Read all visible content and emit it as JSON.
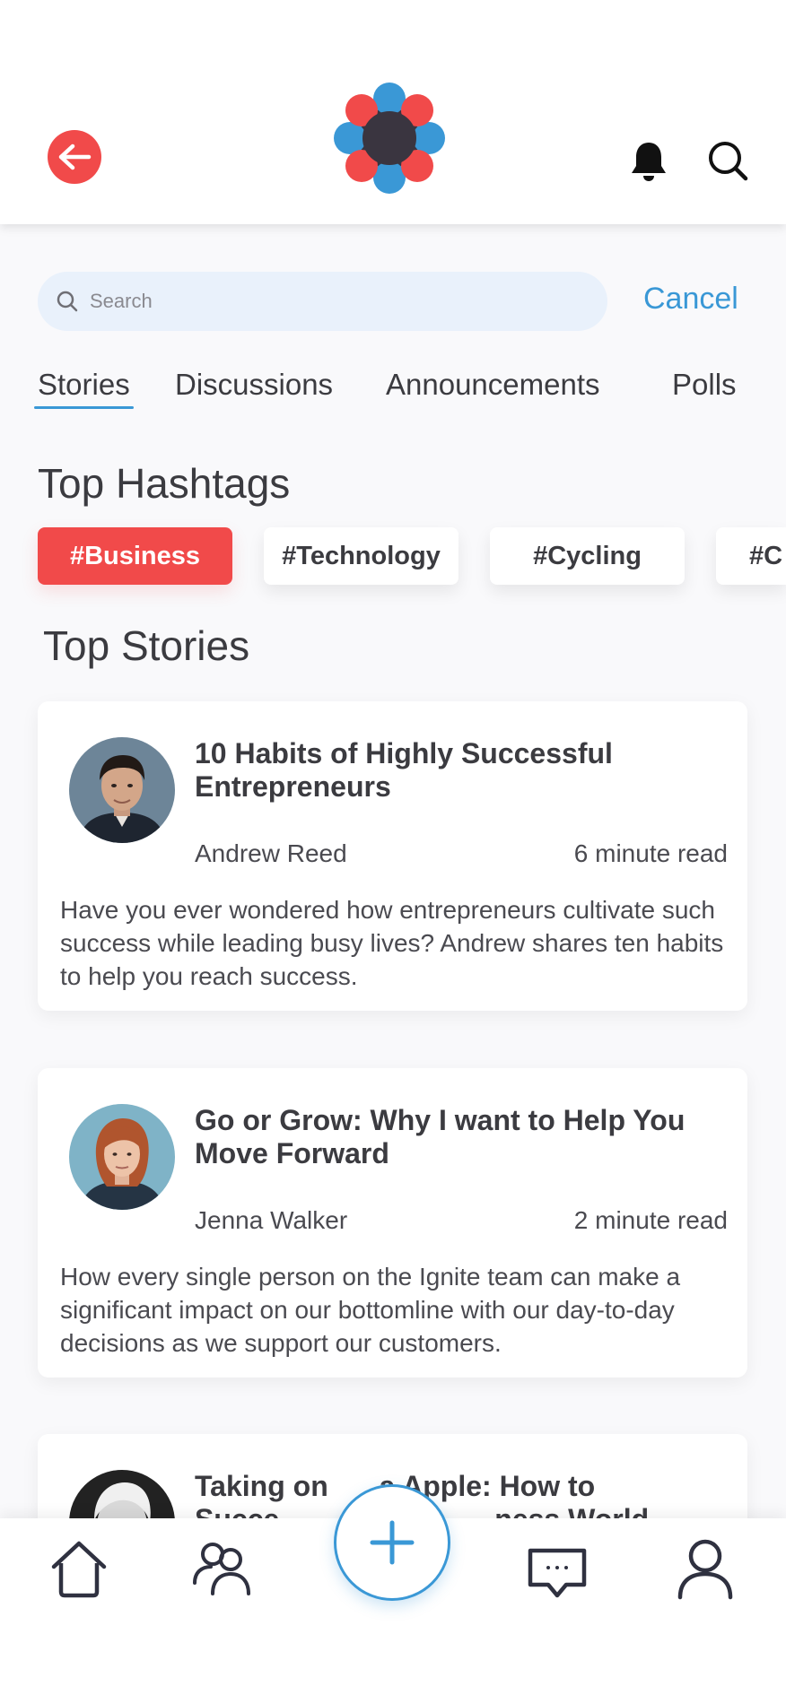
{
  "header": {
    "back_icon": "arrow-left-icon",
    "logo_icon": "flower-logo",
    "notifications_icon": "bell-icon",
    "search_icon": "search-icon"
  },
  "search": {
    "placeholder": "Search",
    "value": "",
    "cancel_label": "Cancel"
  },
  "tabs": [
    {
      "label": "Stories",
      "active": true
    },
    {
      "label": "Discussions",
      "active": false
    },
    {
      "label": "Announcements",
      "active": false
    },
    {
      "label": "Polls",
      "active": false
    }
  ],
  "hashtags": {
    "title": "Top Hashtags",
    "items": [
      "#Business",
      "#Technology",
      "#Cycling",
      "#C"
    ]
  },
  "stories": {
    "title": "Top Stories",
    "items": [
      {
        "title": "10 Habits of Highly Successful Entrepreneurs",
        "author": "Andrew Reed",
        "read_time": "6 minute read",
        "summary": "Have you ever wondered how entrepreneurs cultivate such success while leading busy lives? Andrew shares ten habits to help you reach success."
      },
      {
        "title": "Go or Grow: Why I want to Help You Move Forward",
        "author": "Jenna Walker",
        "read_time": "2 minute read",
        "summary": "How every single person on the Ignite team can make a significant impact on our bottomline with our day-to-day decisions as we support our customers."
      },
      {
        "title": "Taking on Big Apple: How to Succe",
        "title_line1": "Taking on",
        "title_line1_b": "a Apple: How to",
        "title_line2_a": "Succe",
        "title_line2_b": "ness World"
      }
    ]
  },
  "bottom_nav": {
    "items": [
      "home-icon",
      "people-icon",
      "add-icon",
      "chat-icon",
      "profile-icon"
    ]
  },
  "colors": {
    "accent_red": "#f14a4a",
    "accent_blue": "#3a98d6",
    "logo_dark": "#3a3540"
  }
}
